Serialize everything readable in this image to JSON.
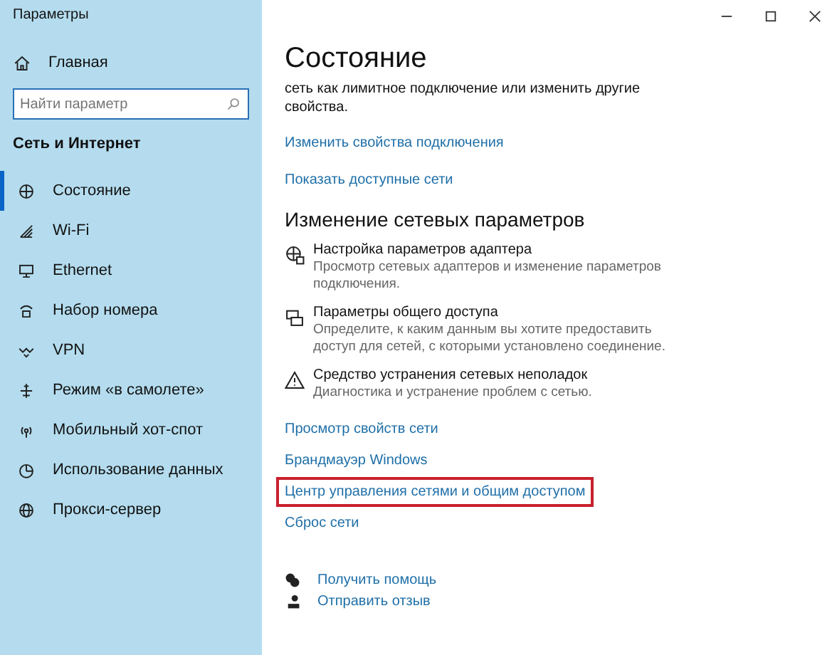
{
  "window": {
    "title": "Параметры"
  },
  "sidebar": {
    "home": "Главная",
    "search": {
      "placeholder": "Найти параметр"
    },
    "section": "Сеть и Интернет",
    "items": [
      {
        "label": "Состояние",
        "selected": true
      },
      {
        "label": "Wi-Fi",
        "selected": false
      },
      {
        "label": "Ethernet",
        "selected": false
      },
      {
        "label": "Набор номера",
        "selected": false
      },
      {
        "label": "VPN",
        "selected": false
      },
      {
        "label": "Режим «в самолете»",
        "selected": false
      },
      {
        "label": "Мобильный хот-спот",
        "selected": false
      },
      {
        "label": "Использование данных",
        "selected": false
      },
      {
        "label": "Прокси-сервер",
        "selected": false
      }
    ]
  },
  "main": {
    "title": "Состояние",
    "intro": "сеть как лимитное подключение или изменить другие свойства.",
    "top_links": [
      "Изменить свойства подключения",
      "Показать доступные сети"
    ],
    "section": "Изменение сетевых параметров",
    "tools": [
      {
        "title": "Настройка параметров адаптера",
        "description": "Просмотр сетевых адаптеров и изменение параметров подключения."
      },
      {
        "title": "Параметры общего доступа",
        "description": "Определите, к каким данным вы хотите предоставить доступ для сетей, с которыми установлено соединение."
      },
      {
        "title": "Средство устранения сетевых неполадок",
        "description": "Диагностика и устранение проблем с сетью."
      }
    ],
    "links": [
      {
        "label": "Просмотр свойств сети",
        "highlighted": false
      },
      {
        "label": "Брандмауэр Windows",
        "highlighted": false
      },
      {
        "label": "Центр управления сетями и общим доступом",
        "highlighted": true
      },
      {
        "label": "Сброс сети",
        "highlighted": false
      }
    ],
    "help": [
      "Получить помощь",
      "Отправить отзыв"
    ]
  }
}
